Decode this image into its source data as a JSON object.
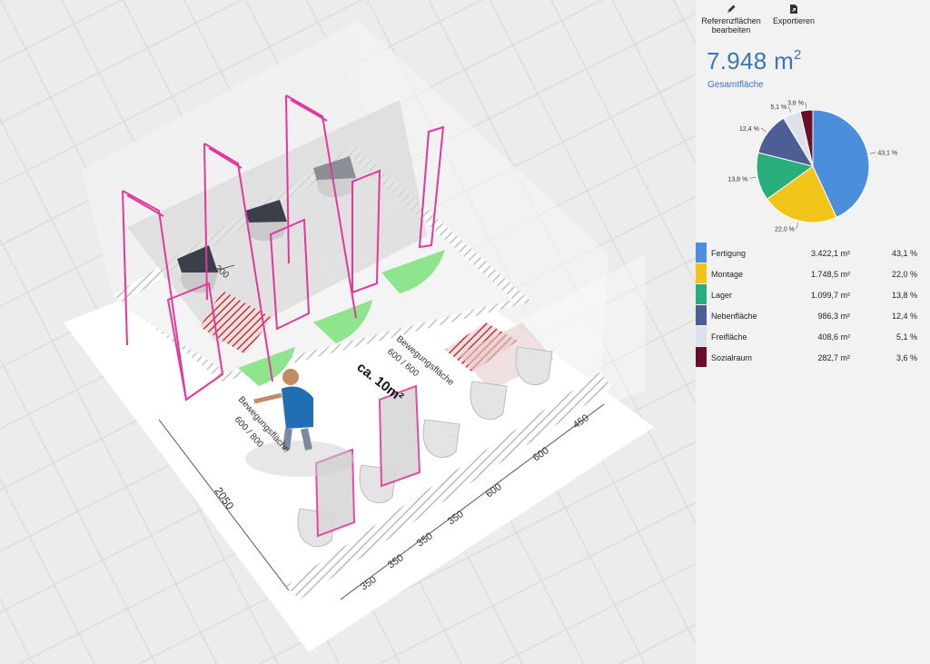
{
  "toolbar": {
    "edit_label_line1": "Referenzflächen",
    "edit_label_line2": "bearbeiten",
    "export_label": "Exportieren"
  },
  "summary": {
    "total_number": "7.948 m",
    "total_sup": "2",
    "total_label": "Gesamtfläche"
  },
  "legend": [
    {
      "name": "Fertigung",
      "value": "3.422,1 m²",
      "pct": "43,1 %",
      "color": "#4a8edc"
    },
    {
      "name": "Montage",
      "value": "1.748,5 m²",
      "pct": "22,0 %",
      "color": "#f0c419"
    },
    {
      "name": "Lager",
      "value": "1.099,7 m²",
      "pct": "13,8 %",
      "color": "#27ae7a"
    },
    {
      "name": "Nebenfläche",
      "value": "986,3 m²",
      "pct": "12,4 %",
      "color": "#4c5e94"
    },
    {
      "name": "Freifläche",
      "value": "408,6 m²",
      "pct": "5,1 %",
      "color": "#dde2ea"
    },
    {
      "name": "Sozialraum",
      "value": "282,7 m²",
      "pct": "3,6 %",
      "color": "#6b0e28"
    }
  ],
  "chart_data": {
    "type": "pie",
    "categories": [
      "Fertigung",
      "Montage",
      "Lager",
      "Nebenfläche",
      "Freifläche",
      "Sozialraum"
    ],
    "values": [
      43.1,
      22.0,
      13.8,
      12.4,
      5.1,
      3.6
    ],
    "slice_labels": [
      "43,1 %",
      "22,0 %",
      "13,8 %",
      "12,4 %",
      "5,1 %",
      "3,6 %"
    ],
    "colors": [
      "#4a8edc",
      "#f0c419",
      "#27ae7a",
      "#4c5e94",
      "#dde2ea",
      "#6b0e28"
    ]
  },
  "drawing": {
    "area_label": "ca. 10m²",
    "movement_label_1": "Bewegungsfläche",
    "movement_dims_1": "600 / 600",
    "movement_label_2": "Bewegungsfläche",
    "movement_dims_2": "600 / 800",
    "dim_depth": "2050",
    "dim_gap": "200",
    "dims_bottom": [
      "350",
      "350",
      "350",
      "350",
      "600",
      "600",
      "450"
    ]
  }
}
